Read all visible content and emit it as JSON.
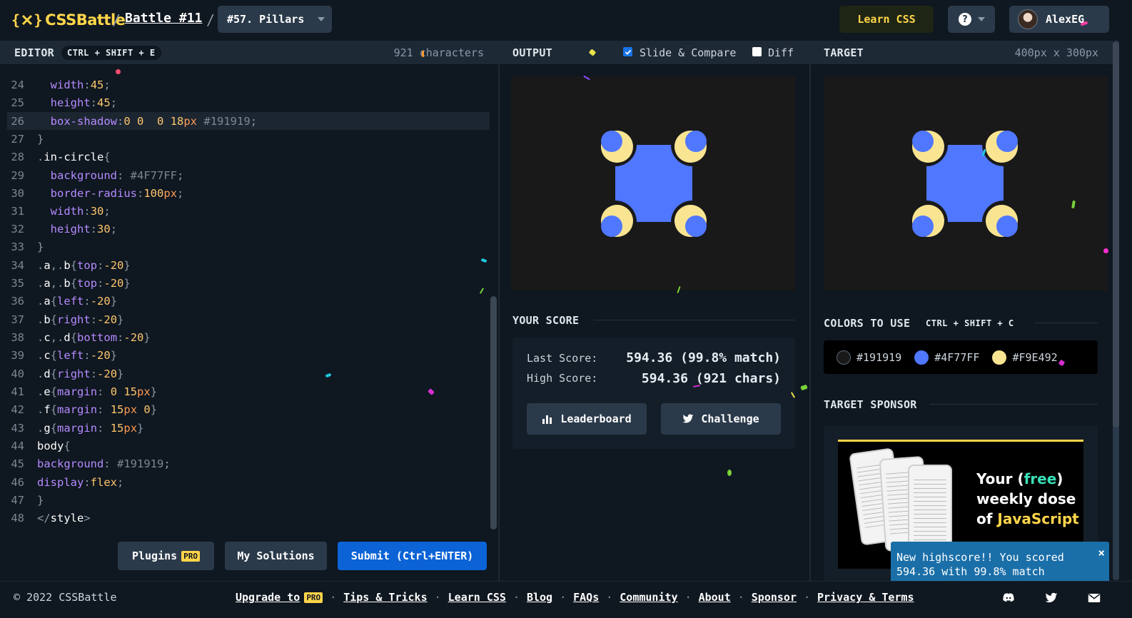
{
  "header": {
    "logo_text": "CSSBattle",
    "crumb_sep": "/",
    "battle_link": "Battle #11",
    "target_select": "#57. Pillars",
    "learn_button": "Learn CSS",
    "help_symbol": "?",
    "user_name": "AlexEG"
  },
  "editor": {
    "title": "EDITOR",
    "shortcut": "CTRL + SHIFT + E",
    "char_count": "921 characters",
    "lines": [
      {
        "n": "24"
      },
      {
        "n": "25"
      },
      {
        "n": "26"
      },
      {
        "n": "27"
      },
      {
        "n": "28"
      },
      {
        "n": "29"
      },
      {
        "n": "30"
      },
      {
        "n": "31"
      },
      {
        "n": "32"
      },
      {
        "n": "33"
      },
      {
        "n": "34"
      },
      {
        "n": "35"
      },
      {
        "n": "36"
      },
      {
        "n": "37"
      },
      {
        "n": "38"
      },
      {
        "n": "39"
      },
      {
        "n": "40"
      },
      {
        "n": "41"
      },
      {
        "n": "42"
      },
      {
        "n": "43"
      },
      {
        "n": "44"
      },
      {
        "n": "45"
      },
      {
        "n": "46"
      },
      {
        "n": "47"
      },
      {
        "n": "48"
      }
    ],
    "plugins_button": "Plugins",
    "pro_badge": "PRO",
    "solutions_button": "My Solutions",
    "submit_button": "Submit (Ctrl+ENTER)"
  },
  "output": {
    "title": "OUTPUT",
    "slide_compare": "Slide & Compare",
    "slide_compare_checked": true,
    "diff": "Diff",
    "diff_checked": false
  },
  "target": {
    "title": "TARGET",
    "size": "400px x 300px"
  },
  "score": {
    "title": "YOUR SCORE",
    "last_label": "Last Score:",
    "last_value": "594.36 (99.8% match)",
    "high_label": "High Score:",
    "high_value": "594.36 (921 chars)",
    "leaderboard_button": "Leaderboard",
    "challenge_button": "Challenge"
  },
  "colors": {
    "title": "COLORS TO USE",
    "shortcut": "CTRL + SHIFT + C",
    "swatches": [
      {
        "hex": "#191919",
        "label": "#191919"
      },
      {
        "hex": "#4F77FF",
        "label": "#4F77FF"
      },
      {
        "hex": "#F9E492",
        "label": "#F9E492"
      }
    ]
  },
  "sponsor": {
    "title": "TARGET SPONSOR",
    "line1a": "Your (",
    "line1b": "free",
    "line1c": ")",
    "line2": "weekly dose",
    "line3a": "of ",
    "line3b": "JavaScript"
  },
  "toast": {
    "message": "New highscore!! You scored 594.36 with 99.8% match",
    "close": "×"
  },
  "footer": {
    "copyright": "© 2022 CSSBattle",
    "upgrade": "Upgrade to",
    "pro": "PRO",
    "links": [
      "Tips & Tricks",
      "Learn CSS",
      "Blog",
      "FAQs",
      "Community",
      "About",
      "Sponsor",
      "Privacy & Terms"
    ],
    "sep": "·"
  },
  "accent_colors": {
    "brand_yellow": "#ffd54a",
    "submit_blue": "#0b63d6",
    "toast_blue": "#1b6fa8"
  }
}
